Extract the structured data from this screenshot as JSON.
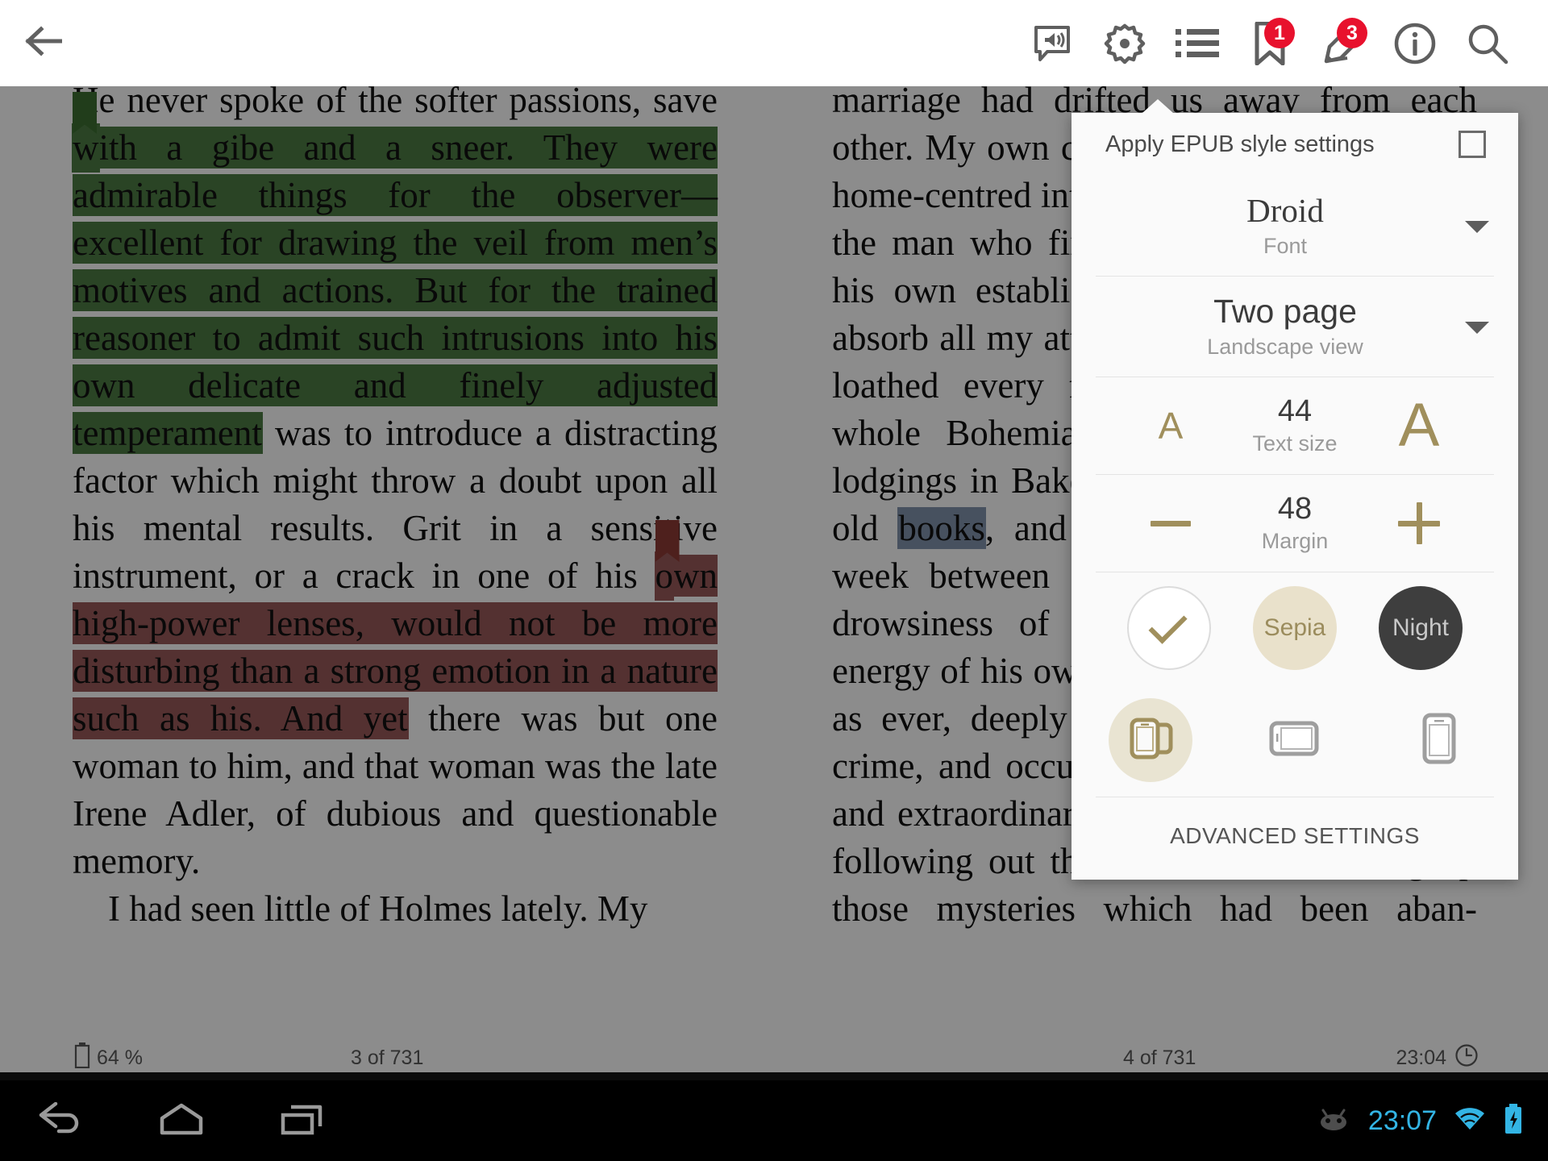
{
  "toolbar": {
    "back_label": "Back",
    "actions": [
      {
        "name": "tts-icon",
        "label": "Text to speech",
        "badge": null
      },
      {
        "name": "settings-gear-icon",
        "label": "Settings",
        "badge": null
      },
      {
        "name": "table-of-contents-icon",
        "label": "Contents",
        "badge": null
      },
      {
        "name": "bookmark-icon",
        "label": "Bookmarks",
        "badge": "1"
      },
      {
        "name": "highlight-pencil-icon",
        "label": "Annotations",
        "badge": "3"
      },
      {
        "name": "info-icon",
        "label": "Info",
        "badge": null
      },
      {
        "name": "search-icon",
        "label": "Search",
        "badge": null
      }
    ]
  },
  "book": {
    "left_page": {
      "para1_a": "He never spoke of the softer passions, save ",
      "hl_green_1": "w",
      "hl_green_2": "ith a gibe and a sneer. They were admirable things for the observer—excellent for drawing the veil from men’s motives and actions. But for the trained reasoner to admit such intrusions into his own delicate and finely adjusted temperament",
      "para1_b": " was to introduce a distracting factor which might throw a doubt upon all his mental results. Grit in a sensitive instrument, or a crack in one of his ",
      "hl_red_1": "o",
      "hl_red_2": "wn high-power lenses, would not be more disturbing than a strong emotion in a nature such as his. And yet",
      "para1_c": " there was but one woman to him, and that woman was the late Irene Adler, of dubious and questionable memory.",
      "para2": "I had seen little of Holmes lately. My"
    },
    "right_page": {
      "para_a": "marriage had drifted us away from each other. My own complete happiness, and the home-centred interests which rise up around the man who first finds himself master of his own establishment, were sufficient to absorb all my attention, while Holmes, who loathed every form of society with his whole Bohemian soul, remained in our lodgings in Baker Street, buried among his old ",
      "hl_blue": "books",
      "para_b": ", and alternating from week to week between cocaine and ambition, the drowsiness of the drug, and the fierce energy of his own keen nature. He was still, as ever, deeply attracted by the study of crime, and occupied his immense faculties and extraordinary powers of observation in following out those clues, and clearing up those mysteries which had been aban-"
    },
    "footer": {
      "battery": "64 %",
      "left_page_number": "3 of 731",
      "right_page_number": "4 of 731",
      "clock": "23:04"
    }
  },
  "settings_panel": {
    "apply_epub_label": "Apply EPUB slyle settings",
    "apply_epub_checked": false,
    "font": {
      "value": "Droid",
      "label": "Font"
    },
    "page_mode": {
      "value": "Two page",
      "label": "Landscape view"
    },
    "text_size": {
      "value": "44",
      "label": "Text size",
      "decrease_glyph": "A",
      "increase_glyph": "A"
    },
    "margin": {
      "value": "48",
      "label": "Margin",
      "decrease_glyph": "—",
      "increase_glyph": "+"
    },
    "themes": [
      {
        "name": "theme-white",
        "label": "",
        "selected": true
      },
      {
        "name": "theme-sepia",
        "label": "Sepia",
        "selected": false
      },
      {
        "name": "theme-night",
        "label": "Night",
        "selected": false
      }
    ],
    "orientations": [
      {
        "name": "orientation-auto-rotate-icon",
        "selected": true
      },
      {
        "name": "orientation-landscape-lock-icon",
        "selected": false
      },
      {
        "name": "orientation-portrait-lock-icon",
        "selected": false
      }
    ],
    "advanced_settings_label": "ADVANCED SETTINGS",
    "accent_color": "#a08f5c",
    "sepia_color": "#e9e1cb",
    "night_color": "#3e3e3e"
  },
  "system_bar": {
    "back_icon": "android-back-icon",
    "home_icon": "android-home-icon",
    "recents_icon": "android-recents-icon",
    "os_logo": "cyanogenmod-logo-icon",
    "clock": "23:07",
    "wifi_icon": "wifi-icon",
    "battery_icon": "battery-charging-icon",
    "accent_color": "#33b5e5"
  }
}
